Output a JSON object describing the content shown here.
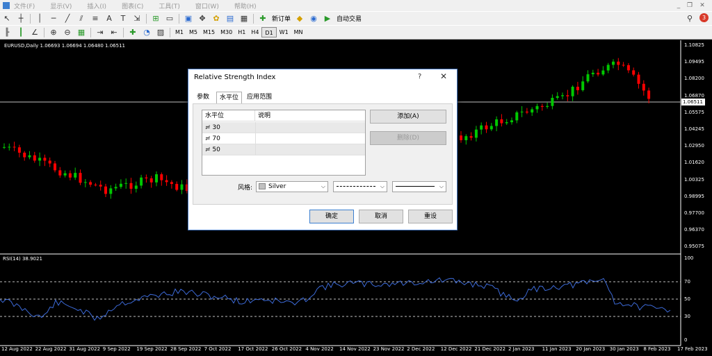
{
  "menu": [
    "文件(F)",
    "显示(V)",
    "插入(I)",
    "图表(C)",
    "工具(T)",
    "窗口(W)",
    "帮助(H)"
  ],
  "toolbar": {
    "new_order": "新订单",
    "auto_trading": "自动交易",
    "notification_count": "3"
  },
  "timeframes": [
    "M1",
    "M5",
    "M15",
    "M30",
    "H1",
    "H4",
    "D1",
    "W1",
    "MN"
  ],
  "active_timeframe": "D1",
  "chart": {
    "title": "EURUSD,Daily  1.06693 1.06694 1.06480 1.06511",
    "current_price": "1.06511",
    "price_labels": [
      "1.10825",
      "1.09495",
      "1.08200",
      "1.06870",
      "1.05575",
      "1.04245",
      "1.02950",
      "1.01620",
      "1.00325",
      "0.98995",
      "0.97700",
      "0.96370",
      "0.95075"
    ],
    "rsi_title": "RSI(14) 38.9021",
    "rsi_labels": [
      "100",
      "70",
      "50",
      "30",
      "0"
    ],
    "date_labels": [
      "12 Aug 2022",
      "22 Aug 2022",
      "31 Aug 2022",
      "9 Sep 2022",
      "19 Sep 2022",
      "28 Sep 2022",
      "7 Oct 2022",
      "17 Oct 2022",
      "26 Oct 2022",
      "4 Nov 2022",
      "14 Nov 2022",
      "23 Nov 2022",
      "2 Dec 2022",
      "12 Dec 2022",
      "21 Dec 2022",
      "2 Jan 2023",
      "11 Jan 2023",
      "20 Jan 2023",
      "30 Jan 2023",
      "8 Feb 2023",
      "17 Feb 2023"
    ],
    "colors": {
      "bull": "#00c800",
      "bear": "#ff0000",
      "rsi": "#3c6ad8",
      "level": "#c0c0c0"
    }
  },
  "dialog": {
    "title": "Relative Strength Index",
    "help": "?",
    "close": "✕",
    "tabs": [
      "参数",
      "水平位",
      "应用范围"
    ],
    "active_tab": "水平位",
    "columns": [
      "水平位",
      "说明"
    ],
    "levels": [
      {
        "value": "30",
        "description": ""
      },
      {
        "value": "70",
        "description": ""
      },
      {
        "value": "50",
        "description": ""
      }
    ],
    "add_button": "添加(A)",
    "delete_button": "删除(D)",
    "style_label": "风格:",
    "color_value": "Silver",
    "ok_button": "确定",
    "cancel_button": "取消",
    "reset_button": "重设"
  }
}
